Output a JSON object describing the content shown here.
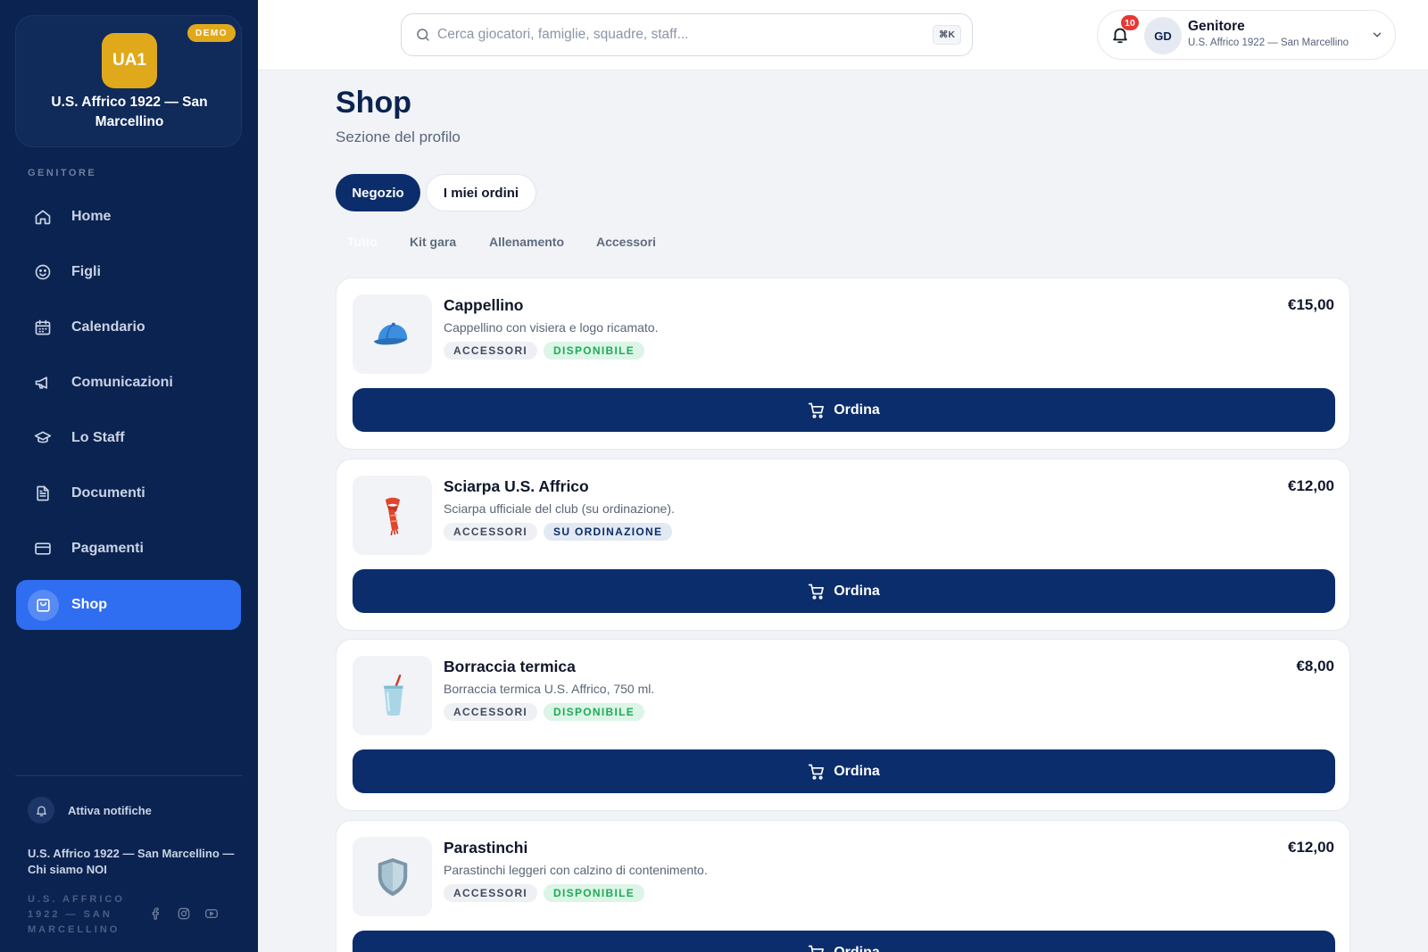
{
  "sidebar": {
    "club_logo": "UA1",
    "demo_badge": "DEMO",
    "club_name": "U.S. Affrico 1922 — San Marcellino",
    "section_label": "GENITORE",
    "items": [
      {
        "label": "Home",
        "icon": "home-icon"
      },
      {
        "label": "Figli",
        "icon": "smile-icon"
      },
      {
        "label": "Calendario",
        "icon": "calendar-icon"
      },
      {
        "label": "Comunicazioni",
        "icon": "megaphone-icon"
      },
      {
        "label": "Lo Staff",
        "icon": "graduation-cap-icon"
      },
      {
        "label": "Documenti",
        "icon": "document-icon"
      },
      {
        "label": "Pagamenti",
        "icon": "credit-card-icon"
      },
      {
        "label": "Shop",
        "icon": "shopping-bag-icon",
        "active": true
      }
    ],
    "notifications_toggle": "Attiva notifiche",
    "about_link": "U.S. Affrico 1922 — San Marcellino — Chi siamo NOI",
    "footer_org": "U.S. AFFRICO 1922 — SAN MARCELLINO"
  },
  "topbar": {
    "search_placeholder": "Cerca giocatori, famiglie, squadre, staff...",
    "search_shortcut": "⌘K",
    "notification_count": "10",
    "avatar_initials": "GD",
    "user_role": "Genitore",
    "user_club": "U.S. Affrico 1922 — San Marcellino"
  },
  "main": {
    "title": "Shop",
    "subtitle": "Sezione del profilo",
    "tabs": [
      {
        "label": "Negozio",
        "active": true
      },
      {
        "label": "I miei ordini",
        "active": false
      }
    ],
    "filters": [
      {
        "label": "Tutto",
        "selected": true
      },
      {
        "label": "Kit gara",
        "selected": false
      },
      {
        "label": "Allenamento",
        "selected": false
      },
      {
        "label": "Accessori",
        "selected": false
      }
    ],
    "order_label": "Ordina",
    "products": [
      {
        "name": "Cappellino",
        "description": "Cappellino con visiera e logo ricamato.",
        "price": "€15,00",
        "category": "ACCESSORI",
        "status": "DISPONIBILE",
        "status_type": "ok",
        "image": "cap-icon"
      },
      {
        "name": "Sciarpa U.S. Affrico",
        "description": "Sciarpa ufficiale del club (su ordinazione).",
        "price": "€12,00",
        "category": "ACCESSORI",
        "status": "SU ORDINAZIONE",
        "status_type": "order",
        "image": "scarf-icon"
      },
      {
        "name": "Borraccia termica",
        "description": "Borraccia termica U.S. Affrico, 750 ml.",
        "price": "€8,00",
        "category": "ACCESSORI",
        "status": "DISPONIBILE",
        "status_type": "ok",
        "image": "cup-icon"
      },
      {
        "name": "Parastinchi",
        "description": "Parastinchi leggeri con calzino di contenimento.",
        "price": "€12,00",
        "category": "ACCESSORI",
        "status": "DISPONIBILE",
        "status_type": "ok",
        "image": "shield-icon"
      }
    ]
  },
  "colors": {
    "sidebar_bg": "#0b2350",
    "accent": "#2f6df1",
    "primary_button": "#0b2d6b",
    "gold": "#e0a91c",
    "available_green": "#1faa59",
    "notification_red": "#e53935"
  }
}
